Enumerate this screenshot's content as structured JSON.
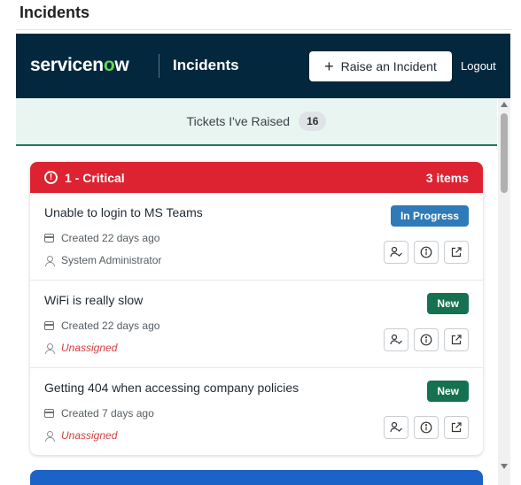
{
  "page": {
    "title": "Incidents"
  },
  "topbar": {
    "brand_prefix": "servicen",
    "brand_o": "o",
    "brand_suffix": "w",
    "app_title": "Incidents",
    "raise_label": "Raise an Incident",
    "logout_label": "Logout",
    "background": "#03283d"
  },
  "tickets_bar": {
    "label": "Tickets I've Raised",
    "count": "16"
  },
  "group": {
    "label": "1 - Critical",
    "count_label": "3 items",
    "color": "#dd2231",
    "tickets": [
      {
        "title": "Unable to login to MS Teams",
        "created": "Created 22 days ago",
        "assignee": "System Administrator",
        "unassigned": false,
        "status": "In Progress",
        "status_kind": "progress"
      },
      {
        "title": "WiFi is really slow",
        "created": "Created 22 days ago",
        "assignee": "Unassigned",
        "unassigned": true,
        "status": "New",
        "status_kind": "new"
      },
      {
        "title": "Getting 404 when accessing company policies",
        "created": "Created 7 days ago",
        "assignee": "Unassigned",
        "unassigned": true,
        "status": "New",
        "status_kind": "new"
      }
    ]
  },
  "icons": {
    "assign": "assign-user-icon",
    "info": "info-icon",
    "open": "external-link-icon",
    "calendar": "calendar-icon",
    "person": "person-icon",
    "alert": "alert-circle-icon"
  },
  "colors": {
    "in_progress": "#2f7ab8",
    "new": "#157150",
    "unassigned_text": "#d43d3d",
    "next_group": "#1b63c6"
  }
}
